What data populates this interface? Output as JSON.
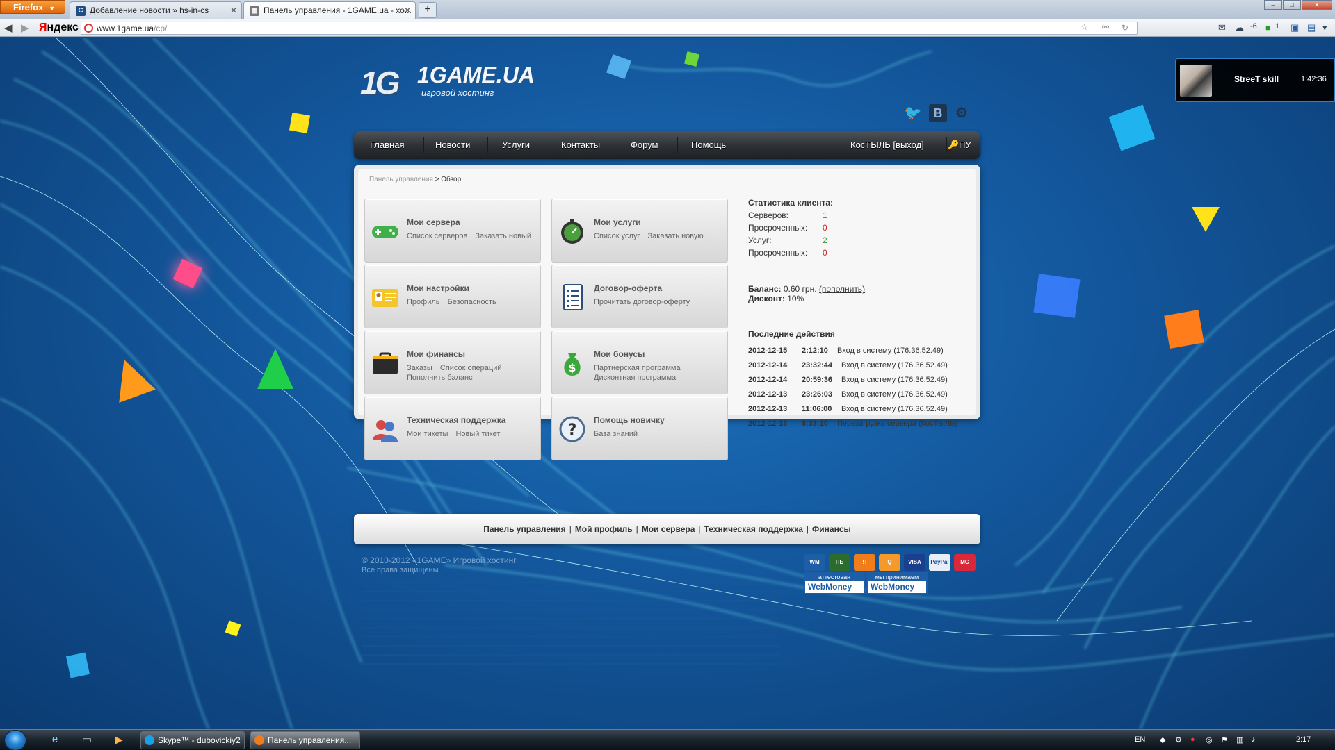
{
  "browser": {
    "menu_button": "Firefox",
    "tabs": [
      {
        "label": "Добавление новости » hs-in-cs",
        "favicon": "С"
      },
      {
        "label": "Панель управления - 1GAME.ua - хо...",
        "favicon": "▦"
      }
    ],
    "new_tab": "+",
    "search_logo": {
      "y": "Я",
      "rest": "ндекс"
    },
    "url_host": "www.1game.ua",
    "url_path": "/cp/",
    "weather_temp": "-6",
    "badge_count": "1"
  },
  "site": {
    "logo_mark": "1G",
    "logo_name": "1GAME.UA",
    "logo_tagline": "игровой хостинг",
    "nav": [
      {
        "label": "Главная"
      },
      {
        "label": "Новости"
      },
      {
        "label": "Услуги"
      },
      {
        "label": "Контакты"
      },
      {
        "label": "Форум"
      },
      {
        "label": "Помощь"
      }
    ],
    "user_label": "КосТЫЛЬ [выход]",
    "pu_label": "ПУ"
  },
  "breadcrumb": {
    "root": "Панель управления",
    "sep": " > ",
    "current": "Обзор"
  },
  "tiles": [
    {
      "title": "Мои сервера",
      "links": [
        "Список серверов",
        "Заказать новый"
      ],
      "icon": "gamepad-icon"
    },
    {
      "title": "Мои услуги",
      "links": [
        "Список услуг",
        "Заказать новую"
      ],
      "icon": "stopwatch-icon"
    },
    {
      "title": "Мои настройки",
      "links": [
        "Профиль",
        "Безопасность"
      ],
      "icon": "id-card-icon"
    },
    {
      "title": "Договор-оферта",
      "links": [
        "Прочитать договор-оферту"
      ],
      "icon": "document-icon"
    },
    {
      "title": "Мои финансы",
      "links": [
        "Заказы",
        "Список операций",
        "Пополнить баланс"
      ],
      "icon": "briefcase-icon"
    },
    {
      "title": "Мои бонусы",
      "links": [
        "Партнерская программа",
        "Дисконтная программа"
      ],
      "icon": "money-bag-icon"
    },
    {
      "title": "Техническая поддержка",
      "links": [
        "Мои тикеты",
        "Новый тикет"
      ],
      "icon": "support-users-icon"
    },
    {
      "title": "Помощь новичку",
      "links": [
        "База знаний"
      ],
      "icon": "question-icon"
    }
  ],
  "stats": {
    "title": "Статистика клиента:",
    "rows": [
      {
        "label": "Серверов:",
        "value": "1",
        "color": "#2a9a2a"
      },
      {
        "label": "Просроченных:",
        "value": "0",
        "color": "#d02020"
      },
      {
        "label": "Услуг:",
        "value": "2",
        "color": "#2a9a2a"
      },
      {
        "label": "Просроченных:",
        "value": "0",
        "color": "#d02020"
      }
    ],
    "balance_label": "Баланс:",
    "balance_value": "0.60 грн.",
    "balance_link": "(пополнить)",
    "discount_label": "Дисконт:",
    "discount_value": "10%"
  },
  "actions": {
    "title": "Последние действия",
    "items": [
      {
        "date": "2012-12-15",
        "time": "2:12:10",
        "event": "Вход в систему (176.36.52.49)"
      },
      {
        "date": "2012-12-14",
        "time": "23:32:44",
        "event": "Вход в систему (176.36.52.49)"
      },
      {
        "date": "2012-12-14",
        "time": "20:59:36",
        "event": "Вход в систему (176.36.52.49)"
      },
      {
        "date": "2012-12-13",
        "time": "23:26:03",
        "event": "Вход в систему (176.36.52.49)"
      },
      {
        "date": "2012-12-13",
        "time": "11:06:00",
        "event": "Вход в систему (176.36.52.49)"
      },
      {
        "date": "2012-12-13",
        "time": "8:33:10",
        "event": "Перезагрузка сервера (КосТЫЛЬ)"
      }
    ]
  },
  "footer": {
    "links": [
      "Панель управления",
      "Мой профиль",
      "Мои сервера",
      "Техническая поддержка",
      "Финансы"
    ],
    "copyright": "© 2010-2012 «1GAME» Игровой хостинг",
    "rights": "Все права защищены",
    "payments": [
      "WM",
      "ПБ",
      "Я",
      "Q",
      "VISA",
      "PayPal",
      "MC"
    ],
    "wm_badges": [
      {
        "top": "аттестован",
        "bottom": "WebMoney"
      },
      {
        "top": "мы принимаем",
        "bottom": "WebMoney"
      }
    ]
  },
  "skype_popup": {
    "name": "StreeT skill",
    "time": "1:42:36"
  },
  "taskbar": {
    "tasks": [
      {
        "label": "Skype™ - dubovickiy2"
      },
      {
        "label": "Панель управления..."
      }
    ],
    "lang": "EN",
    "clock": "2:17"
  }
}
